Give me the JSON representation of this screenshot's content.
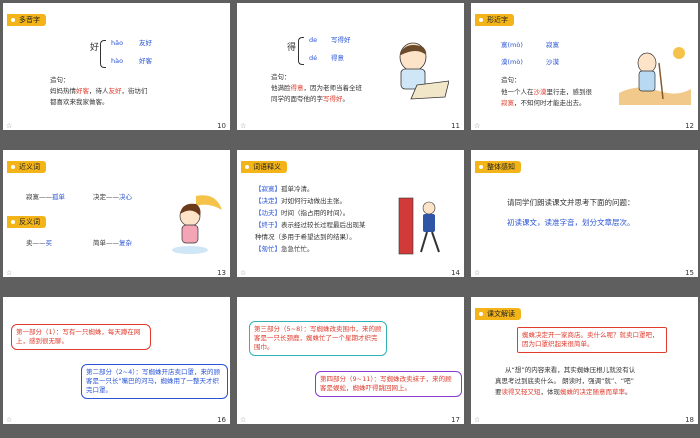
{
  "slides": [
    {
      "num": "10",
      "tag": "多音字",
      "char": "好",
      "p1": "hǎo",
      "w1": "友好",
      "p2": "hào",
      "w2": "好客",
      "ex_label": "造句：",
      "ex_a": "妈妈热情",
      "ex_b": "好客",
      "ex_c": "，待人",
      "ex_d": "友好",
      "ex_e": "，街坊们",
      "ex_f": "都喜欢来我家做客。"
    },
    {
      "num": "11",
      "char": "得",
      "p1": "de",
      "w1": "写得好",
      "p2": "dé",
      "w2": "得意",
      "ex_label": "造句：",
      "ex_a": "他满脸",
      "ex_b": "得意",
      "ex_c": "，因为老师当着全班",
      "ex_d": "同学的面夸他的字",
      "ex_e": "写得好",
      "ex_f": "。"
    },
    {
      "num": "12",
      "tag": "形近字",
      "c1": "寞",
      "p1": "(mò)",
      "w1": "寂寞",
      "c2": "漠",
      "p2": "(mò)",
      "w2": "沙漠",
      "ex_label": "造句：",
      "ex_a": "他一个人在",
      "ex_b": "沙漠",
      "ex_c": "里行走，感到很",
      "ex_d": "寂寞",
      "ex_e": "，不知何时才能走出去。"
    },
    {
      "num": "13",
      "tag1": "近义词",
      "syn1a": "寂寞——",
      "syn1b": "孤单",
      "syn2a": "决定——",
      "syn2b": "决心",
      "tag2": "反义词",
      "ant1a": "卖——",
      "ant1b": "买",
      "ant2a": "简单——",
      "ant2b": "复杂"
    },
    {
      "num": "14",
      "tag": "词语释义",
      "defs": [
        {
          "w": "【寂寞】",
          "d": "孤单冷清。"
        },
        {
          "w": "【决定】",
          "d": "对如何行动做出主张。"
        },
        {
          "w": "【功夫】",
          "d": "时间（指占用的时间）。"
        },
        {
          "w": "【终于】",
          "d": "表示经过较长过程最后出现某"
        },
        {
          "w": "",
          "d": "种情况（多用于希望达到的结果）。"
        },
        {
          "w": "【匆忙】",
          "d": "急急忙忙。"
        }
      ]
    },
    {
      "num": "15",
      "tag": "整体感知",
      "q": "请同学们朗读课文并思考下面的问题：",
      "a": "初读课文，读准字音，划分文章层次。"
    },
    {
      "num": "16",
      "b1": "第一部分（1）：写有一只蜘蛛，每天蹲在网上，感到很无聊。",
      "b2": "第二部分（2~4）：写蜘蛛开店卖口罩，来的顾客是一只长\"嘴巴的河马，蜘蛛用了一整天才织完口罩。"
    },
    {
      "num": "17",
      "b1": "第三部分（5~8）：写蜘蛛改卖围巾，来的顾客是一只长颈鹿，蜘蛛忙了一个星期才织完围巾。",
      "b2": "第四部分（9~11）：写蜘蛛改卖袜子，来的顾客是蜈蚣，蜘蛛吓得跳回网上。"
    },
    {
      "num": "18",
      "tag": "课文解读",
      "box": "蜘蛛决定开一家商店。卖什么呢？就卖口罩吧，因为口罩织起来很简单。",
      "p1": "从“想”的内容来看，其实蜘蛛压根儿就没有认",
      "p2": "真思考过到底卖什么。 朗读时，强调“就”、“吧”",
      "p3a": "要",
      "p3b": "读得又轻又短",
      "p3c": "，体现",
      "p3d": "蜘蛛的决定随意而草率",
      "p3e": "。"
    }
  ],
  "star": "☆"
}
